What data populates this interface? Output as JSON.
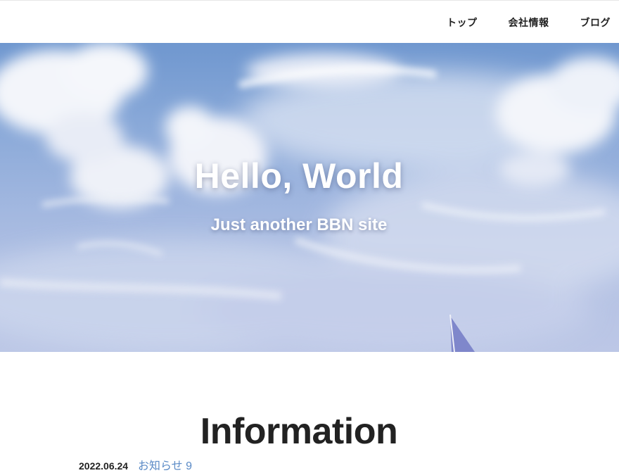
{
  "nav": {
    "items": [
      {
        "label": "トップ"
      },
      {
        "label": "会社情報"
      },
      {
        "label": "ブログ"
      }
    ]
  },
  "hero": {
    "title": "Hello, World",
    "subtitle": "Just another BBN site"
  },
  "information": {
    "heading": "Information",
    "posts": [
      {
        "date": "2022.06.24",
        "title": "お知らせ 9"
      }
    ]
  },
  "colors": {
    "link": "#5a8ac6",
    "text": "#222222",
    "sky_top": "#6f97cf"
  }
}
